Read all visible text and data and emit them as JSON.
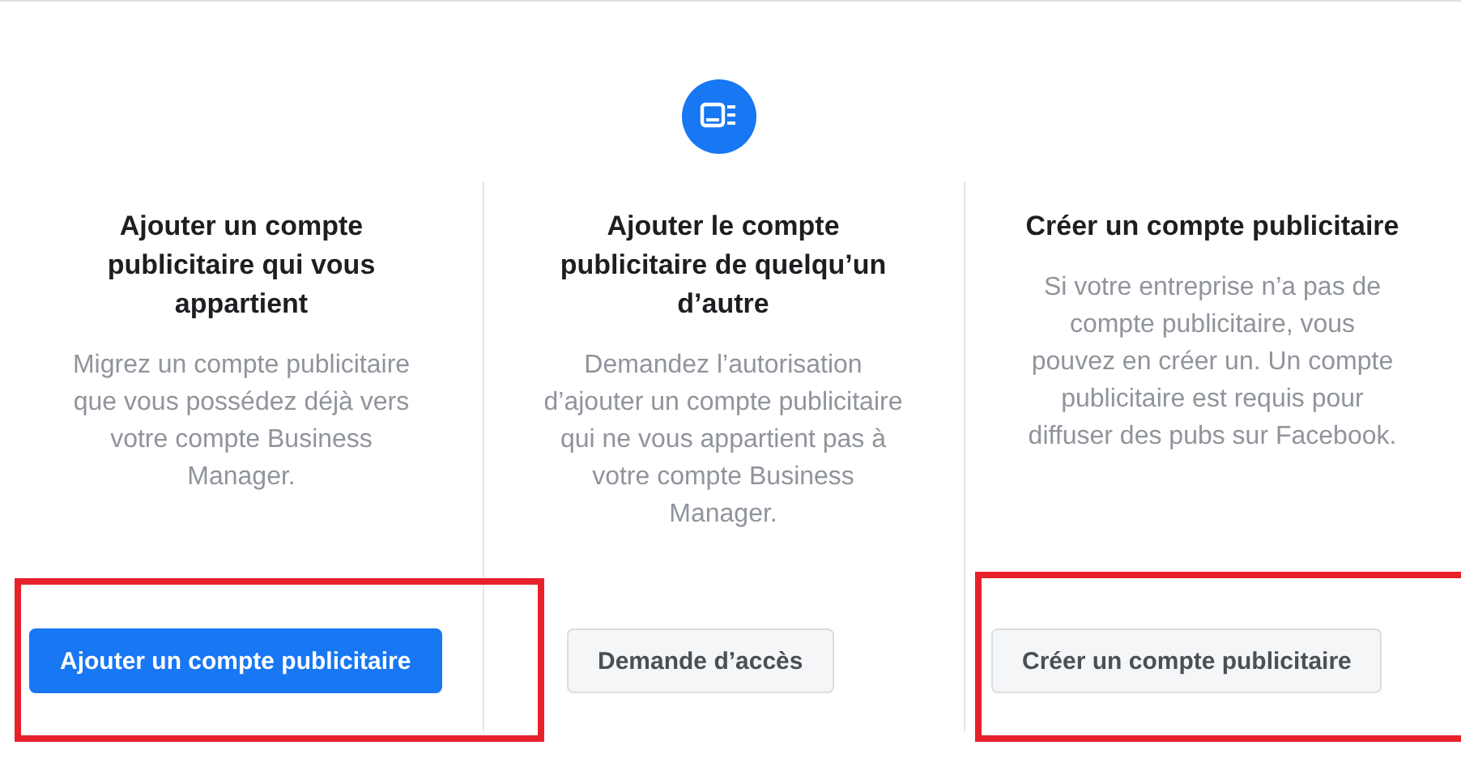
{
  "options": [
    {
      "title": "Ajouter un compte publicitaire qui vous appartient",
      "description": "Migrez un compte publicitaire que vous possédez déjà vers votre compte Business Manager.",
      "button": {
        "label": "Ajouter un compte publicitaire",
        "kind": "primary"
      },
      "highlighted": true
    },
    {
      "title": "Ajouter le compte publicitaire de quelqu’un d’autre",
      "description": "Demandez l’autorisation d’ajouter un compte publicitaire qui ne vous appartient pas à votre compte Business Manager.",
      "button": {
        "label": "Demande d’accès",
        "kind": "secondary"
      },
      "highlighted": false
    },
    {
      "title": "Créer un compte publicitaire",
      "description": "Si votre entreprise n’a pas de compte publicitaire, vous pouvez en créer un. Un compte publicitaire est requis pour diffuser des pubs sur Facebook.",
      "button": {
        "label": "Créer un compte publicitaire",
        "kind": "secondary"
      },
      "highlighted": true
    }
  ]
}
